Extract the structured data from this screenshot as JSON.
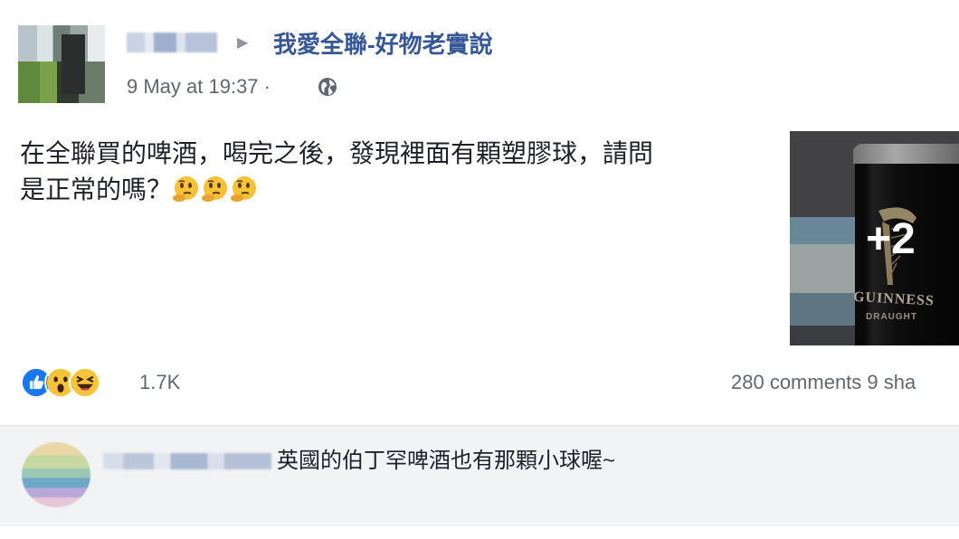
{
  "post": {
    "group_name": "我愛全聯-好物老實說",
    "timestamp": "9 May at 19:37 ·",
    "text_line1": "在全聯買的啤酒，喝完之後，發現裡面有顆塑膠球，請問",
    "text_line2": "是正常的嗎？",
    "photo_more": "+2",
    "photo_brand": "GUINNESS",
    "photo_sub": "DRAUGHT",
    "reactions_count": "1.7K",
    "counts_text": "280 comments  9 sha",
    "icons": [
      "globe-icon",
      "like-icon",
      "wow-icon",
      "haha-icon",
      "thinking-face-icon"
    ]
  },
  "comment": {
    "text": "英國的伯丁罕啤酒也有那顆小球喔~"
  },
  "colors": {
    "link": "#365899",
    "meta": "#616770",
    "like": "#1877f2",
    "comment_bg": "#f2f3f5"
  }
}
